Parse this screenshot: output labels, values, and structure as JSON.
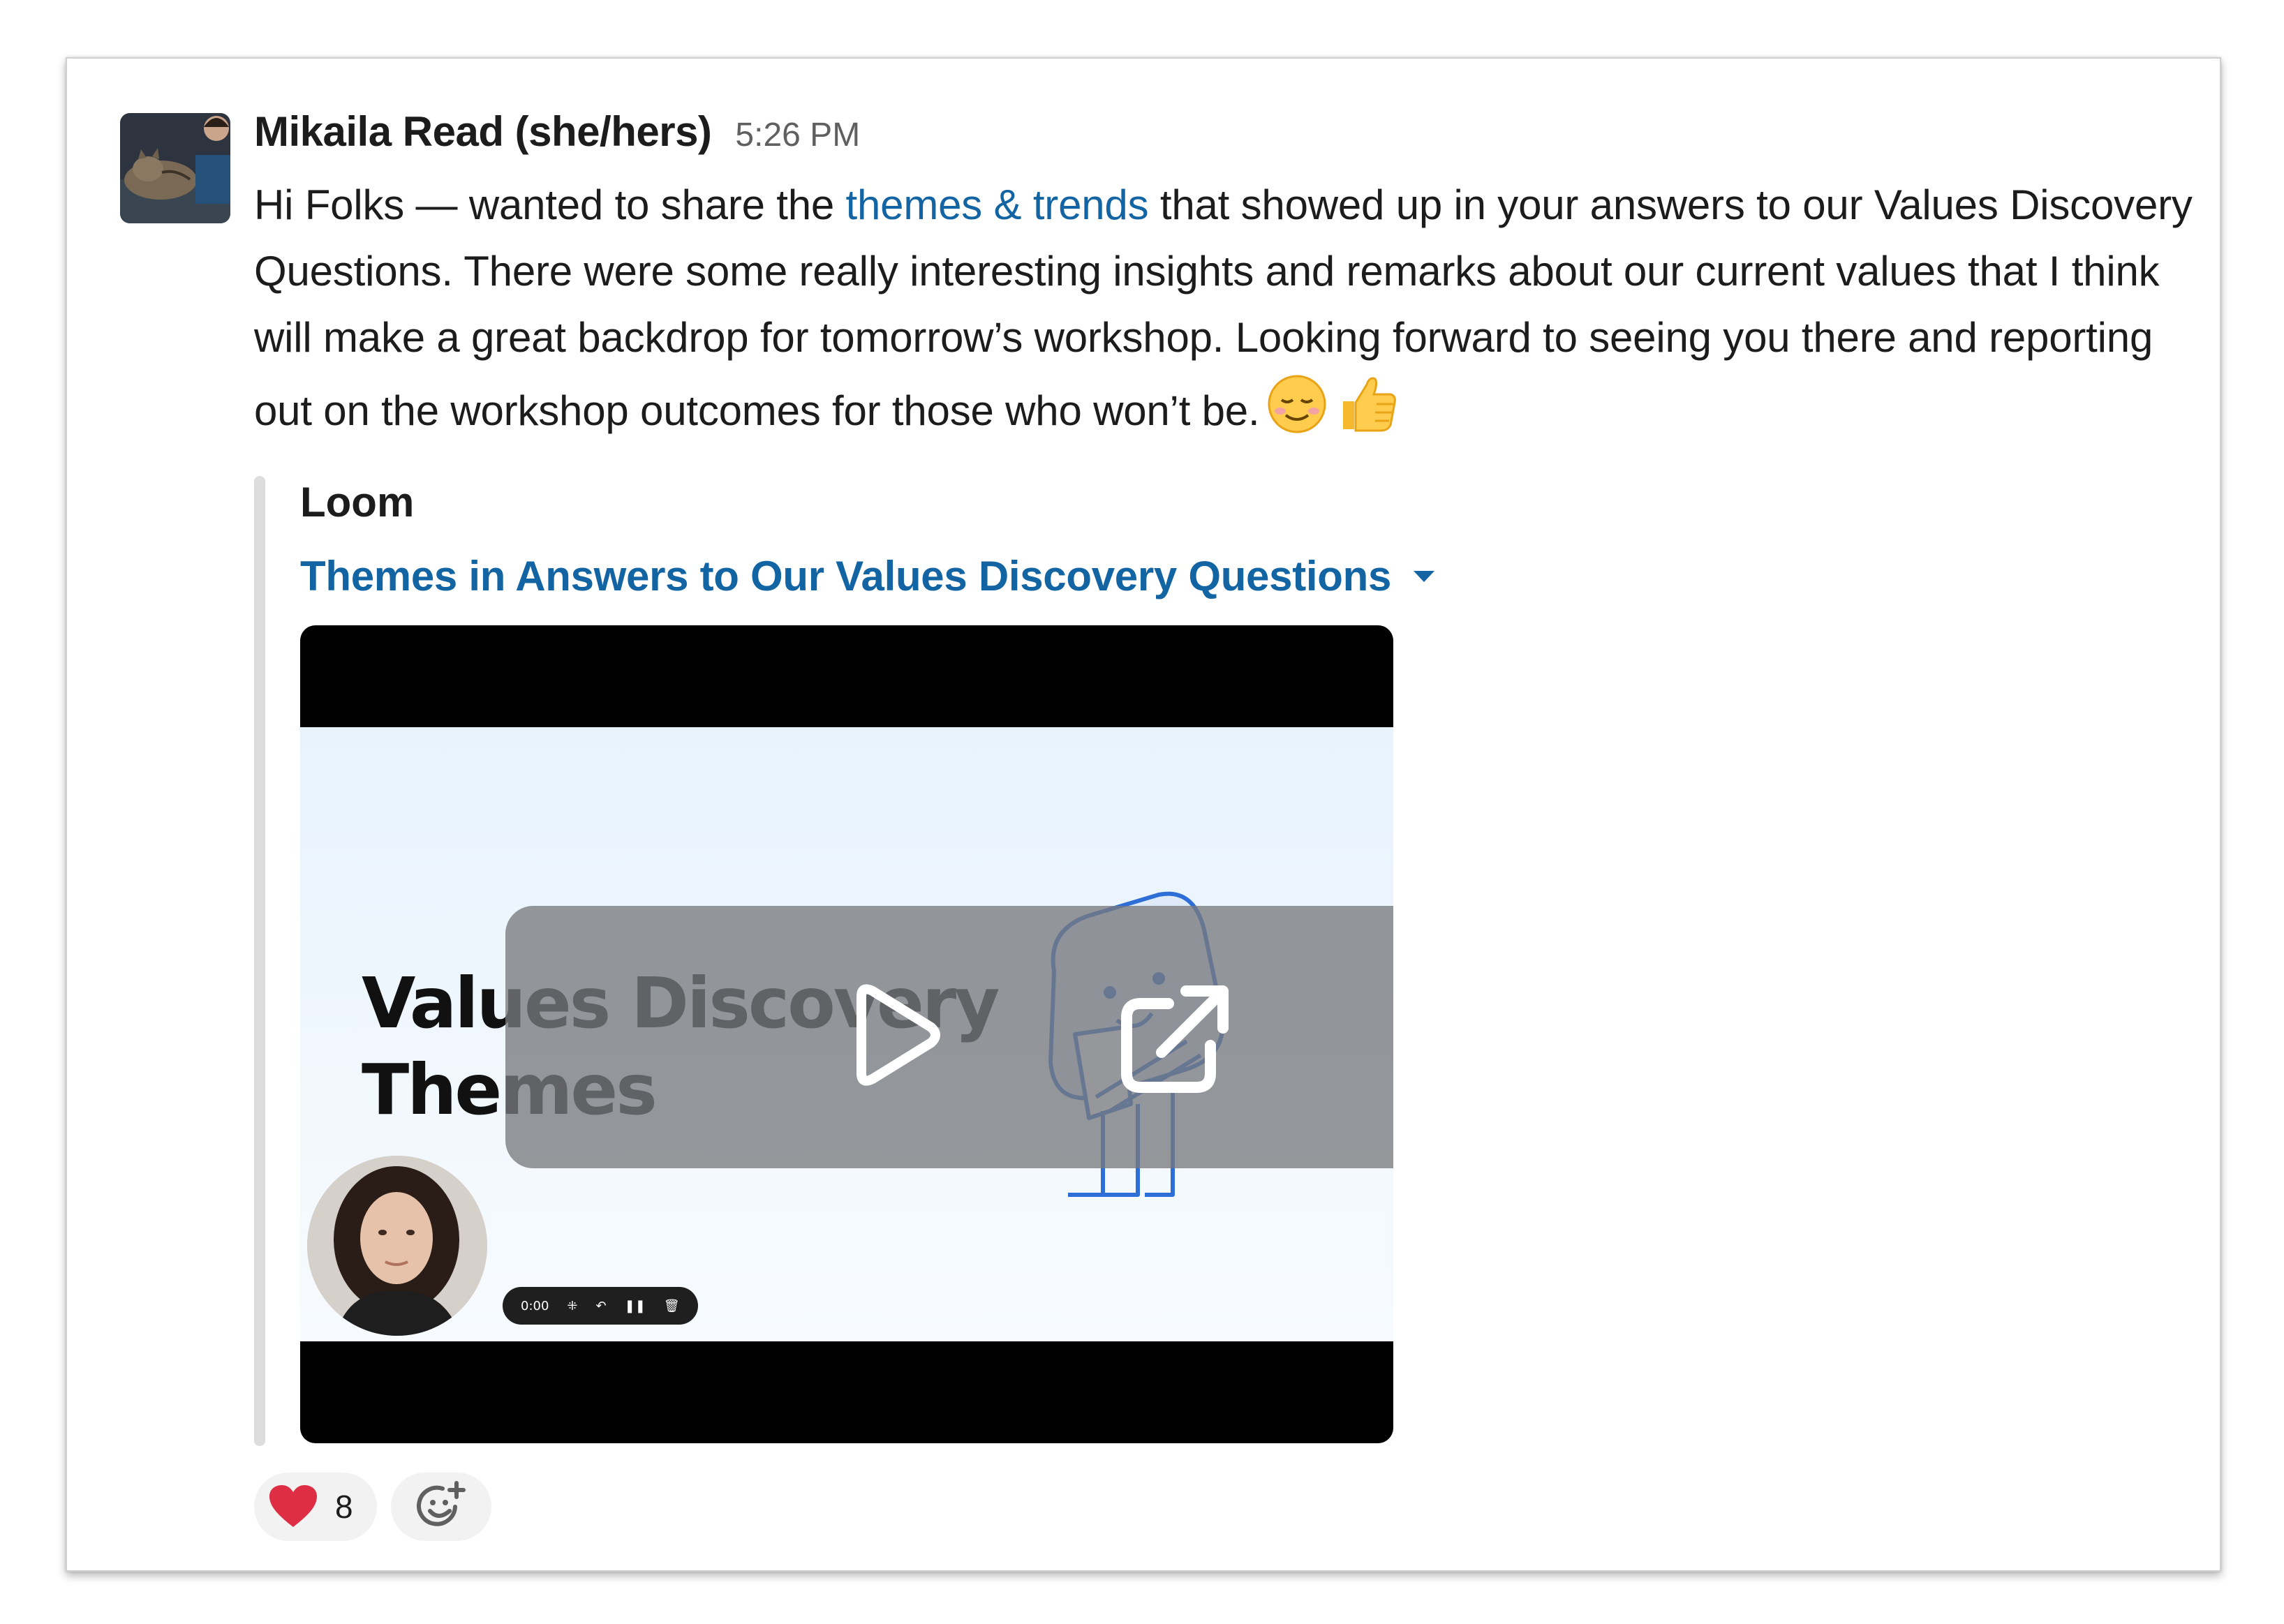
{
  "message": {
    "author": "Mikaila Read (she/hers)",
    "time": "5:26 PM",
    "text_before_link": "Hi Folks — wanted to share the ",
    "link_text": "themes & trends",
    "text_after_link": " that showed up in your answers to our Values Discovery Questions. There were some really interesting insights and remarks about our current values that I think will make a great backdrop for tomorrow’s workshop. Looking forward to seeing you there and reporting out on the workshop outcomes for those who won’t be.",
    "emojis": [
      "relaxed-face-emoji",
      "thumbs-up-emoji"
    ]
  },
  "attachment": {
    "service": "Loom",
    "title": "Themes in Answers to Our Values Discovery Questions",
    "video": {
      "slide_title": "Values Discovery\nThemes",
      "timer": "0:00"
    }
  },
  "reactions": [
    {
      "emoji": "heart-emoji",
      "count": "8"
    }
  ],
  "colors": {
    "link": "#1264a3",
    "text": "#1d1c1d",
    "timestamp": "#616061",
    "reaction_bg": "#f2f2f2"
  }
}
